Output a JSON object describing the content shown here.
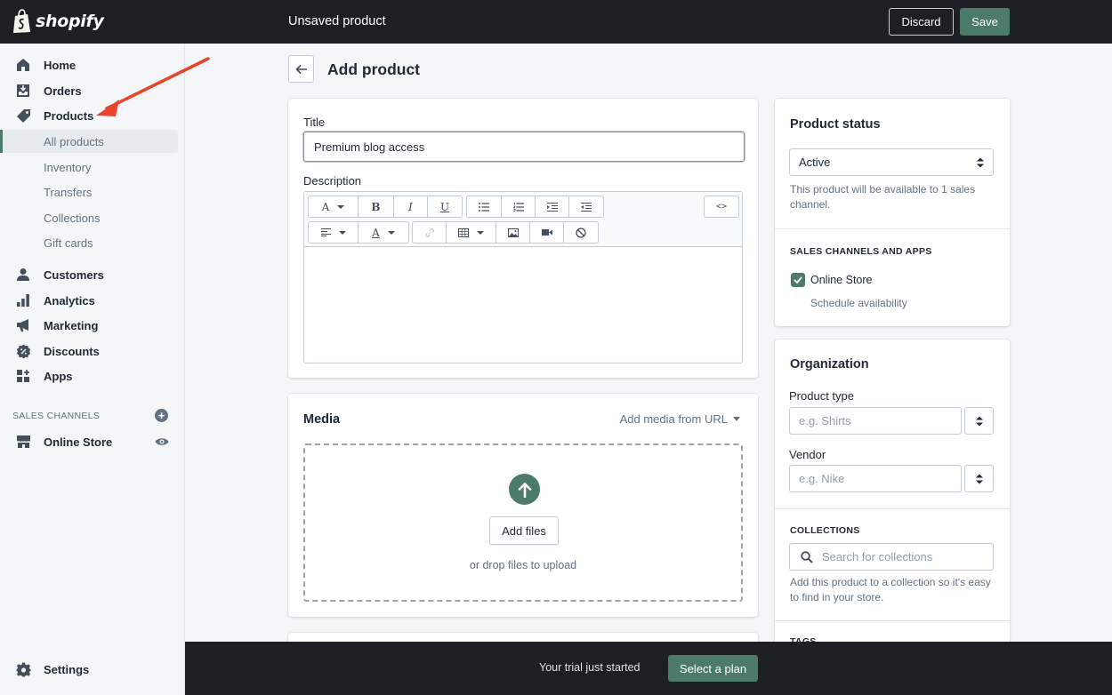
{
  "brand": {
    "logo_text": "shopify",
    "accent": "#4d7b69",
    "annotation_arrow_color": "#e8452c"
  },
  "topbar": {
    "title": "Unsaved product",
    "discard_label": "Discard",
    "save_label": "Save"
  },
  "sidebar": {
    "items": [
      {
        "label": "Home",
        "icon": "home-icon"
      },
      {
        "label": "Orders",
        "icon": "orders-icon"
      },
      {
        "label": "Products",
        "icon": "tag-icon"
      }
    ],
    "product_subitems": [
      "All products",
      "Inventory",
      "Transfers",
      "Collections",
      "Gift cards"
    ],
    "items2": [
      {
        "label": "Customers",
        "icon": "person-icon"
      },
      {
        "label": "Analytics",
        "icon": "bar-chart-icon"
      },
      {
        "label": "Marketing",
        "icon": "megaphone-icon"
      },
      {
        "label": "Discounts",
        "icon": "discount-icon"
      },
      {
        "label": "Apps",
        "icon": "apps-icon"
      }
    ],
    "sales_channels_heading": "SALES CHANNELS",
    "online_store": "Online Store",
    "settings": "Settings"
  },
  "page": {
    "title": "Add product"
  },
  "product": {
    "title_label": "Title",
    "title_value": "Premium blog access",
    "description_label": "Description"
  },
  "media": {
    "heading": "Media",
    "add_from_url": "Add media from URL",
    "add_files": "Add files",
    "drop_text": "or drop files to upload"
  },
  "status": {
    "heading": "Product status",
    "selected": "Active",
    "help": "This product will be available to 1 sales channel.",
    "channels_heading": "SALES CHANNELS AND APPS",
    "channel_name": "Online Store",
    "channel_checked": true,
    "schedule": "Schedule availability"
  },
  "organization": {
    "heading": "Organization",
    "product_type_label": "Product type",
    "product_type_placeholder": "e.g. Shirts",
    "vendor_label": "Vendor",
    "vendor_placeholder": "e.g. Nike",
    "collections_heading": "COLLECTIONS",
    "collections_placeholder": "Search for collections",
    "collections_help": "Add this product to a collection so it's easy to find in your store.",
    "tags_heading": "TAGS"
  },
  "trial": {
    "text": "Your trial just started",
    "button": "Select a plan"
  }
}
